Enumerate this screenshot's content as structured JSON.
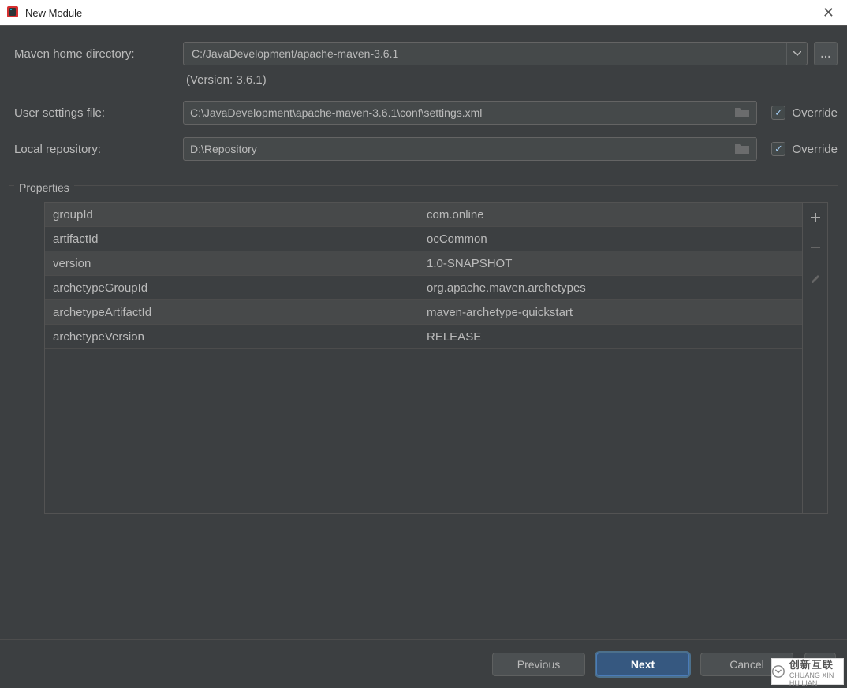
{
  "window": {
    "title": "New Module"
  },
  "mavenHome": {
    "label": "Maven home directory:",
    "value": "C:/JavaDevelopment/apache-maven-3.6.1",
    "version_note": "(Version: 3.6.1)"
  },
  "userSettings": {
    "label": "User settings file:",
    "value": "C:\\JavaDevelopment\\apache-maven-3.6.1\\conf\\settings.xml",
    "override_label": "Override",
    "override_checked": true
  },
  "localRepo": {
    "label": "Local repository:",
    "value": "D:\\Repository",
    "override_label": "Override",
    "override_checked": true
  },
  "properties": {
    "title": "Properties",
    "rows": [
      {
        "key": "groupId",
        "value": "com.online"
      },
      {
        "key": "artifactId",
        "value": "ocCommon"
      },
      {
        "key": "version",
        "value": "1.0-SNAPSHOT"
      },
      {
        "key": "archetypeGroupId",
        "value": "org.apache.maven.archetypes"
      },
      {
        "key": "archetypeArtifactId",
        "value": "maven-archetype-quickstart"
      },
      {
        "key": "archetypeVersion",
        "value": "RELEASE"
      }
    ]
  },
  "buttons": {
    "previous": "Previous",
    "next": "Next",
    "cancel": "Cancel"
  },
  "watermark": {
    "brand": "创新互联",
    "sub": "CHUANG XIN HU LIAN"
  }
}
